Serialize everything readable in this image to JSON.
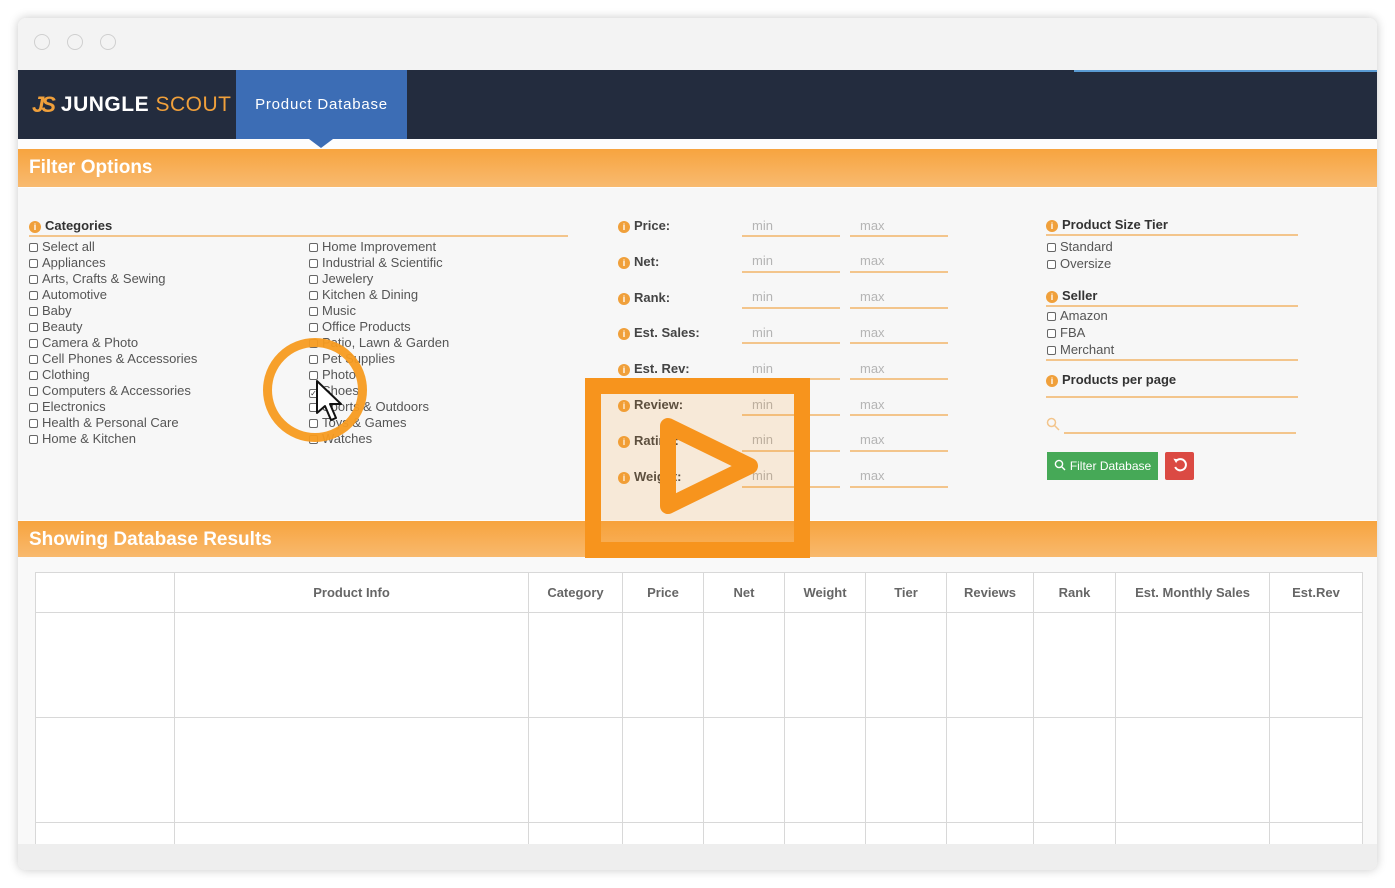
{
  "app": {
    "logo_mark": "JS",
    "logo_jungle": "JUNGLE",
    "logo_scout": "SCOUT",
    "nav_tab": "Product Database"
  },
  "filter_section": {
    "title": "Filter Options",
    "categories_heading": "Categories",
    "categories_col1": [
      {
        "label": "Select all",
        "checked": false
      },
      {
        "label": "Appliances",
        "checked": false
      },
      {
        "label": "Arts, Crafts & Sewing",
        "checked": false
      },
      {
        "label": "Automotive",
        "checked": false
      },
      {
        "label": "Baby",
        "checked": false
      },
      {
        "label": "Beauty",
        "checked": false
      },
      {
        "label": "Camera & Photo",
        "checked": false
      },
      {
        "label": "Cell Phones & Accessories",
        "checked": false
      },
      {
        "label": "Clothing",
        "checked": false
      },
      {
        "label": "Computers & Accessories",
        "checked": false
      },
      {
        "label": "Electronics",
        "checked": false
      },
      {
        "label": "Health & Personal Care",
        "checked": false
      },
      {
        "label": "Home & Kitchen",
        "checked": false
      }
    ],
    "categories_col2": [
      {
        "label": "Home Improvement",
        "checked": false
      },
      {
        "label": "Industrial & Scientific",
        "checked": false
      },
      {
        "label": "Jewelery",
        "checked": false
      },
      {
        "label": "Kitchen & Dining",
        "checked": false
      },
      {
        "label": "Music",
        "checked": false
      },
      {
        "label": "Office Products",
        "checked": false
      },
      {
        "label": "Patio, Lawn & Garden",
        "checked": false
      },
      {
        "label": "Pet Supplies",
        "checked": false
      },
      {
        "label": "Photo",
        "checked": false
      },
      {
        "label": "Shoes",
        "checked": true
      },
      {
        "label": "Sports & Outdoors",
        "checked": false
      },
      {
        "label": "Toys & Games",
        "checked": false
      },
      {
        "label": "Watches",
        "checked": false
      }
    ],
    "range_filters": [
      {
        "label": "Price:",
        "min_placeholder": "min",
        "max_placeholder": "max"
      },
      {
        "label": "Net:",
        "min_placeholder": "min",
        "max_placeholder": "max"
      },
      {
        "label": "Rank:",
        "min_placeholder": "min",
        "max_placeholder": "max"
      },
      {
        "label": "Est. Sales:",
        "min_placeholder": "min",
        "max_placeholder": "max"
      },
      {
        "label": "Est. Rev:",
        "min_placeholder": "min",
        "max_placeholder": "max"
      },
      {
        "label": "Review:",
        "min_placeholder": "min",
        "max_placeholder": "max"
      },
      {
        "label": "Rating:",
        "min_placeholder": "min",
        "max_placeholder": "max"
      },
      {
        "label": "Weight:",
        "min_placeholder": "min",
        "max_placeholder": "max"
      }
    ],
    "size_tier_heading": "Product Size Tier",
    "size_tier_options": [
      "Standard",
      "Oversize"
    ],
    "seller_heading": "Seller",
    "seller_options": [
      "Amazon",
      "FBA",
      "Merchant"
    ],
    "per_page_heading": "Products per page",
    "filter_button": "Filter Database"
  },
  "results_section": {
    "title": "Showing Database Results",
    "columns": [
      "",
      "Product Info",
      "Category",
      "Price",
      "Net",
      "Weight",
      "Tier",
      "Reviews",
      "Rank",
      "Est. Monthly Sales",
      "Est.Rev"
    ]
  },
  "colors": {
    "accent_orange": "#f7941d",
    "nav_dark": "#232c3e",
    "nav_tab_blue": "#3c6db5",
    "filter_green": "#46a957",
    "reset_red": "#db4a43"
  }
}
